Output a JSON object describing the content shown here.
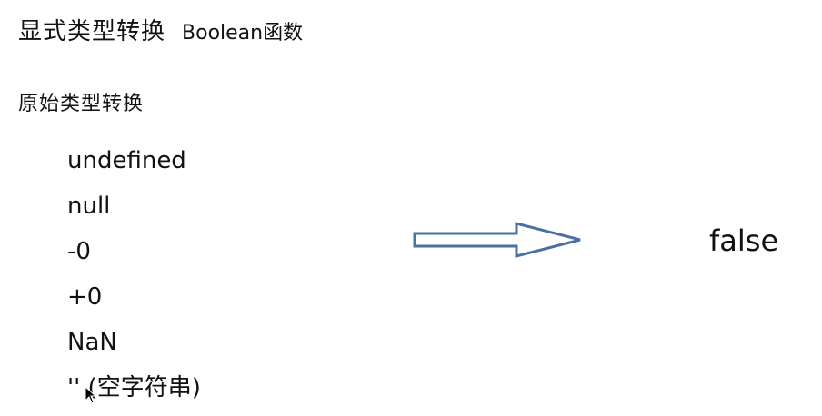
{
  "heading": {
    "main": "显式类型转换",
    "sub": "Boolean函数"
  },
  "subheading": "原始类型转换",
  "values": [
    "undefined",
    "null",
    "-0",
    "+0",
    "NaN",
    "'' (空字符串)"
  ],
  "result": "false",
  "colors": {
    "arrow_stroke": "#4a6fa5",
    "text": "#111111"
  },
  "icons": {
    "arrow": "right-arrow-icon",
    "cursor": "mouse-pointer-icon"
  }
}
